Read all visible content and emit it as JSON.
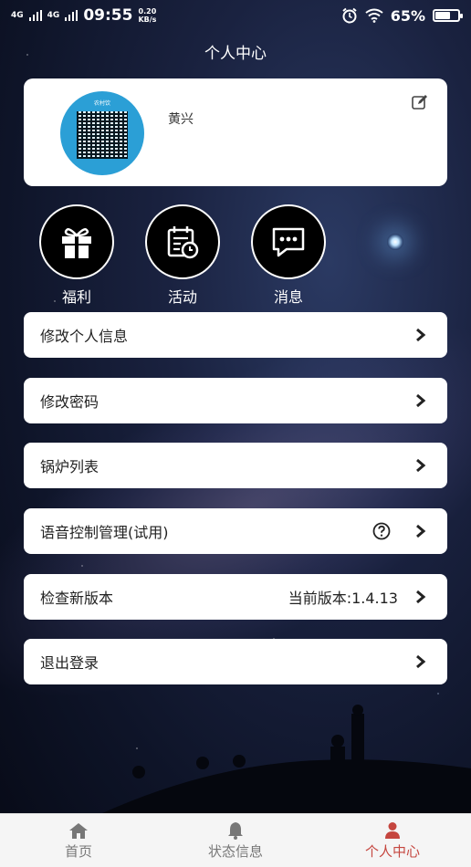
{
  "status_bar": {
    "signal1": "4G",
    "signal2": "4G",
    "time": "09:55",
    "net_speed_value": "0.20",
    "net_speed_unit": "KB/s",
    "battery": "65%",
    "battery_level": 0.65
  },
  "header": {
    "title": "个人中心"
  },
  "profile": {
    "qr_header": "农村饮",
    "name": "黄兴"
  },
  "quick_actions": [
    {
      "label": "福利",
      "icon": "gift-icon"
    },
    {
      "label": "活动",
      "icon": "calendar-clock-icon"
    },
    {
      "label": "消息",
      "icon": "chat-bubble-icon"
    }
  ],
  "menu": {
    "edit_info": "修改个人信息",
    "change_password": "修改密码",
    "boiler_list": "锅炉列表",
    "voice_control": "语音控制管理(试用)",
    "check_update": "检查新版本",
    "current_version": "当前版本:1.4.13",
    "logout": "退出登录"
  },
  "tabs": {
    "home": "首页",
    "status": "状态信息",
    "profile": "个人中心"
  },
  "colors": {
    "active_tab": "#c5463f",
    "inactive_tab": "#777777"
  }
}
